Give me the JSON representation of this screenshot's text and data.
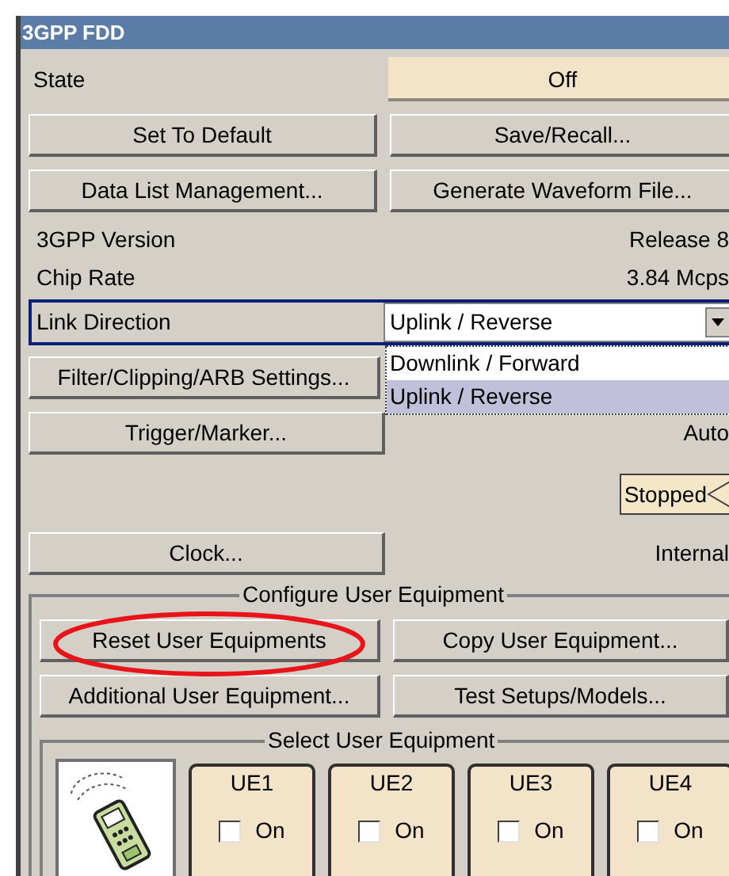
{
  "window": {
    "title": "3GPP FDD"
  },
  "state": {
    "label": "State",
    "value": "Off"
  },
  "top_buttons": [
    "Set To Default",
    "Save/Recall...",
    "Data List Management...",
    "Generate Waveform File..."
  ],
  "info": [
    {
      "label": "3GPP Version",
      "value": "Release 8"
    },
    {
      "label": "Chip Rate",
      "value": "3.84 Mcps"
    }
  ],
  "link_direction": {
    "label": "Link Direction",
    "value": "Uplink / Reverse",
    "expanded": true,
    "options": [
      {
        "label": "Downlink / Forward",
        "selected": false
      },
      {
        "label": "Uplink / Reverse",
        "selected": true
      }
    ]
  },
  "filter_button": "Filter/Clipping/ARB Settings...",
  "trigger": {
    "button": "Trigger/Marker...",
    "value": "Auto",
    "status": "Stopped"
  },
  "clock": {
    "button": "Clock...",
    "value": "Internal"
  },
  "configure_group": {
    "title": "Configure User Equipment",
    "buttons": [
      "Reset User Equipments",
      "Copy User Equipment...",
      "Additional User Equipment...",
      "Test Setups/Models..."
    ]
  },
  "select_group": {
    "title": "Select User Equipment",
    "equipment": [
      {
        "name": "UE1",
        "label": "On",
        "checked": false
      },
      {
        "name": "UE2",
        "label": "On",
        "checked": false
      },
      {
        "name": "UE3",
        "label": "On",
        "checked": false
      },
      {
        "name": "UE4",
        "label": "On",
        "checked": false
      }
    ]
  }
}
